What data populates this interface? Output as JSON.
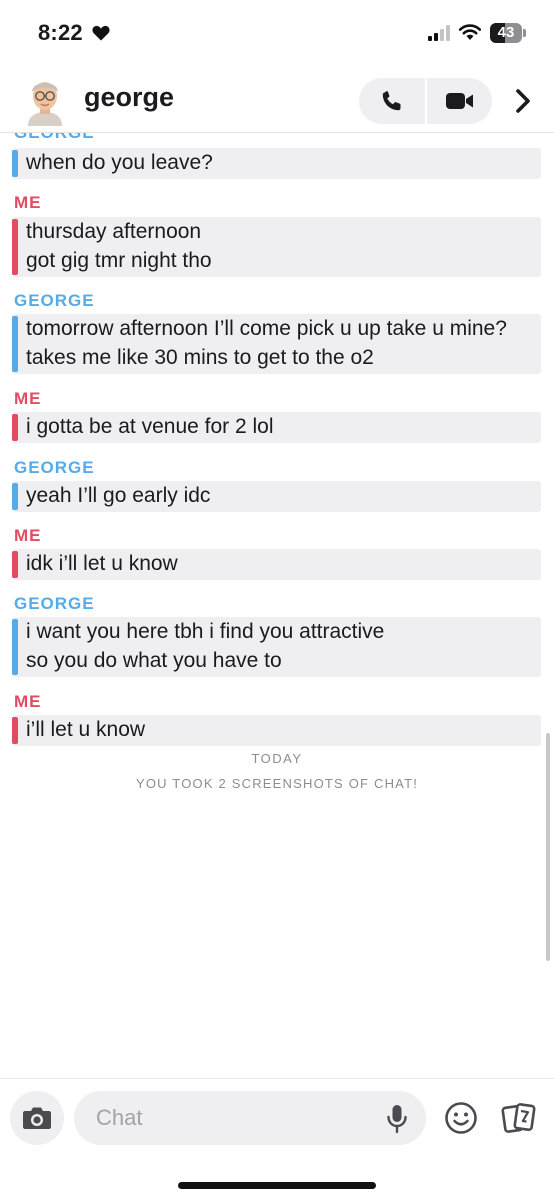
{
  "status_bar": {
    "time": "8:22",
    "battery": "43"
  },
  "header": {
    "contact_name": "george"
  },
  "chat": {
    "clipped_sender": "GEORGE",
    "groups": [
      {
        "sender": "",
        "lines": [
          "when do you leave?"
        ]
      },
      {
        "sender": "ME",
        "lines": [
          "thursday afternoon",
          "got gig tmr night tho"
        ]
      },
      {
        "sender": "GEORGE",
        "lines": [
          "tomorrow afternoon I’ll come pick u up take u mine?",
          "takes me like 30 mins to get to the o2"
        ]
      },
      {
        "sender": "ME",
        "lines": [
          "i gotta be at venue for 2 lol"
        ]
      },
      {
        "sender": "GEORGE",
        "lines": [
          "yeah I’ll go early idc"
        ]
      },
      {
        "sender": "ME",
        "lines": [
          "idk i’ll let u know"
        ]
      },
      {
        "sender": "GEORGE",
        "lines": [
          "i want you here tbh i find you attractive",
          "so you do what you have to"
        ]
      },
      {
        "sender": "ME",
        "lines": [
          "i’ll let u know"
        ]
      }
    ],
    "day_label": "TODAY",
    "screenshot_notice": "YOU TOOK 2 SCREENSHOTS OF CHAT!"
  },
  "composer": {
    "placeholder": "Chat"
  },
  "colors": {
    "george": "#55abe8",
    "me": "#e04d62",
    "bubble": "#efeff2"
  },
  "icons": [
    "heart-icon",
    "signal-icon",
    "wifi-icon",
    "battery-icon",
    "phone-icon",
    "video-icon",
    "chevron-right-icon",
    "camera-icon",
    "mic-icon",
    "emoji-icon",
    "cards-icon"
  ]
}
